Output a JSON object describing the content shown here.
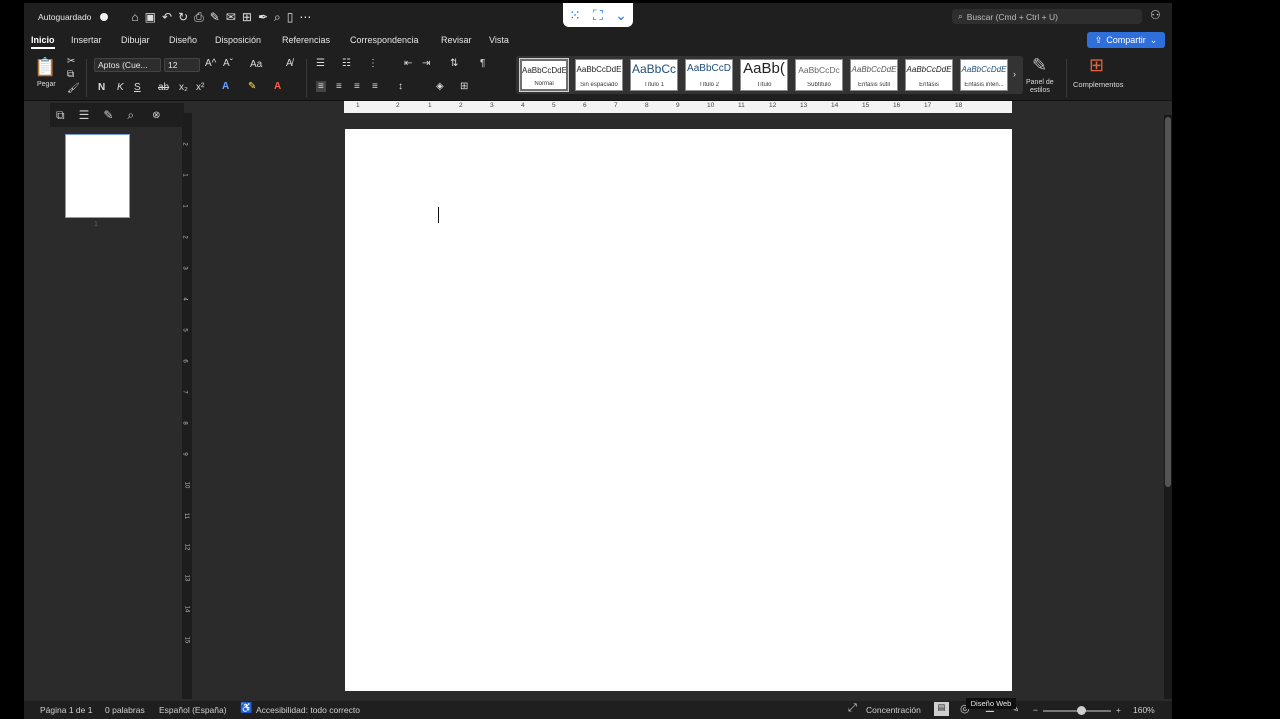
{
  "app": {
    "autosave_label": "Autoguardado",
    "search_placeholder": "Buscar (Cmd + Ctrl + U)",
    "share_label": "Compartir"
  },
  "tabs": [
    "Inicio",
    "Insertar",
    "Dibujar",
    "Diseño",
    "Disposición",
    "Referencias",
    "Correspondencia",
    "Revisar",
    "Vista"
  ],
  "ribbon": {
    "paste_label": "Pegar",
    "font_name": "Aptos (Cue...",
    "font_size": "12",
    "change_case": "Aa",
    "bold": "N",
    "italic": "K",
    "underline": "S",
    "strike": "ab",
    "subscript": "x₂",
    "superscript": "x²",
    "styles": [
      {
        "sample": "AaBbCcDdE",
        "name": "Normal"
      },
      {
        "sample": "AaBbCcDdE",
        "name": "Sin espaciado"
      },
      {
        "sample": "AaBbCc",
        "name": "Título 1"
      },
      {
        "sample": "AaBbCcD",
        "name": "Título 2"
      },
      {
        "sample": "AaBb(",
        "name": "Título"
      },
      {
        "sample": "AaBbCcDc",
        "name": "Subtítulo"
      },
      {
        "sample": "AaBbCcDdE",
        "name": "Énfasis sutil"
      },
      {
        "sample": "AaBbCcDdE",
        "name": "Énfasis"
      },
      {
        "sample": "AaBbCcDdE",
        "name": "Énfasis inten..."
      }
    ],
    "styles_pane_label_1": "Panel de",
    "styles_pane_label_2": "estilos",
    "addins_label": "Complementos"
  },
  "rulers": {
    "horizontal": [
      "1",
      "2",
      "1",
      "2",
      "3",
      "4",
      "5",
      "6",
      "7",
      "8",
      "9",
      "10",
      "11",
      "12",
      "13",
      "14",
      "15",
      "16",
      "17",
      "18"
    ],
    "vertical": [
      "2",
      "1",
      "1",
      "2",
      "3",
      "4",
      "5",
      "6",
      "7",
      "8",
      "9",
      "10",
      "11",
      "12",
      "13",
      "14",
      "15"
    ]
  },
  "navpane": {
    "thumb_page_number": "1"
  },
  "status": {
    "page": "Página 1 de 1",
    "words": "0 palabras",
    "language": "Español (España)",
    "accessibility": "Accesibilidad: todo correcto",
    "focus": "Concentración",
    "tooltip": "Diseño Web",
    "zoom": "160%",
    "zoom_minus": "−",
    "zoom_plus": "+"
  }
}
